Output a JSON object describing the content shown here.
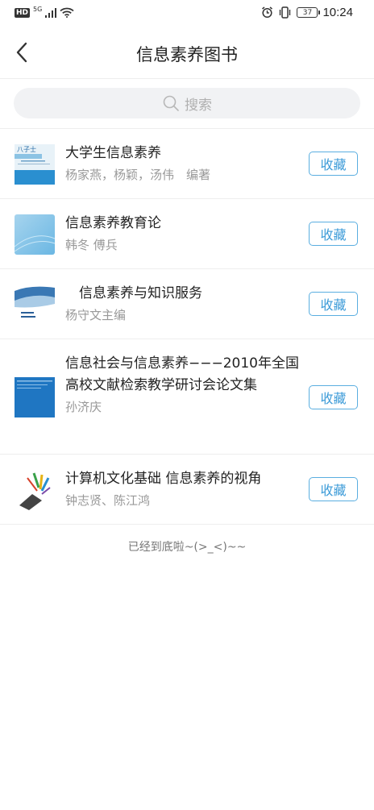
{
  "status_bar": {
    "hd": "HD",
    "network": "5G",
    "battery": "37",
    "time": "10:24"
  },
  "header": {
    "title": "信息素养图书"
  },
  "search": {
    "placeholder": "搜索"
  },
  "books": [
    {
      "title": "大学生信息素养",
      "author": "杨家燕，杨颖，汤伟　编著",
      "button": "收藏"
    },
    {
      "title": "信息素养教育论",
      "author": "韩冬 傅兵",
      "button": "收藏"
    },
    {
      "title": "　信息素养与知识服务",
      "author": "杨守文主编",
      "button": "收藏"
    },
    {
      "title": "信息社会与信息素养−−−2010年全国高校文献检索教学研讨会论文集",
      "author": "孙济庆",
      "button": "收藏"
    },
    {
      "title": "计算机文化基础 信息素养的视角",
      "author": "钟志贤、陈江鸿",
      "button": "收藏"
    }
  ],
  "footer": {
    "note": "已经到底啦~(>_<)~~"
  },
  "colors": {
    "accent": "#3c9bd8",
    "separator": "#eeeeee",
    "search_bg": "#f1f2f4"
  }
}
